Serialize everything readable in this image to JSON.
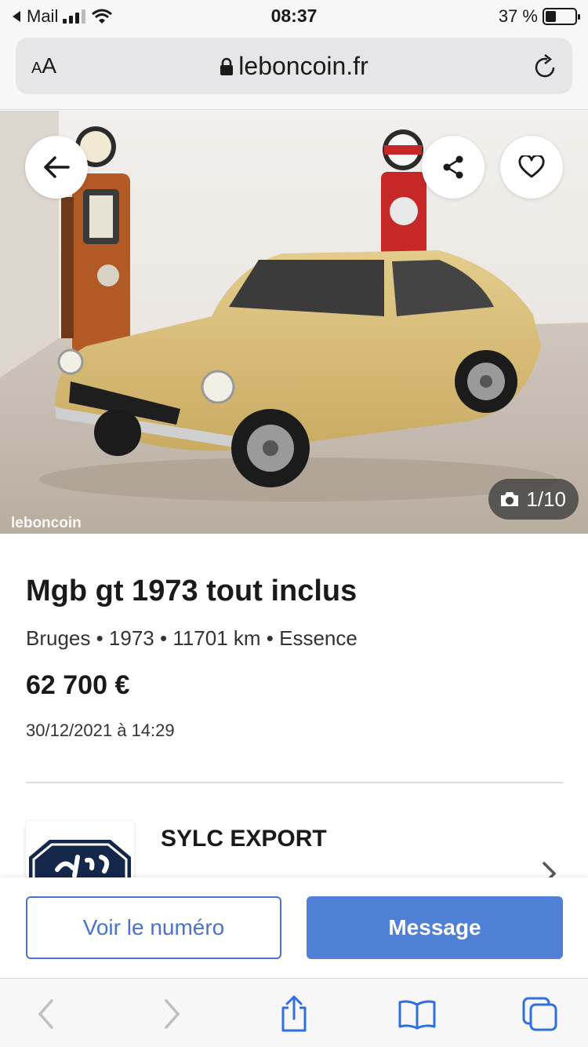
{
  "status_bar": {
    "back_app": "Mail",
    "time": "08:37",
    "battery": "37 %",
    "battery_level": 0.37
  },
  "browser": {
    "text_size_label": "AA",
    "host": "leboncoin.fr"
  },
  "hero": {
    "photo_counter": "1/10",
    "watermark": "leboncoin"
  },
  "ad": {
    "title": "Mgb gt 1973 tout inclus",
    "meta": "Bruges • 1973 • 11701 km • Essence",
    "price": "62 700 €",
    "date": "30/12/2021 à 14:29"
  },
  "seller": {
    "name": "SYLC EXPORT"
  },
  "actions": {
    "call_label": "Voir le numéro",
    "message_label": "Message"
  },
  "colors": {
    "primary": "#4f80d6",
    "car_yellow": "#d6bd7a"
  },
  "icons": [
    "back-arrow-icon",
    "share-icon",
    "heart-icon",
    "camera-icon",
    "lock-icon",
    "reload-icon",
    "chevron-right-icon",
    "safari-back-icon",
    "safari-forward-icon",
    "safari-share-icon",
    "safari-bookmarks-icon",
    "safari-tabs-icon"
  ]
}
